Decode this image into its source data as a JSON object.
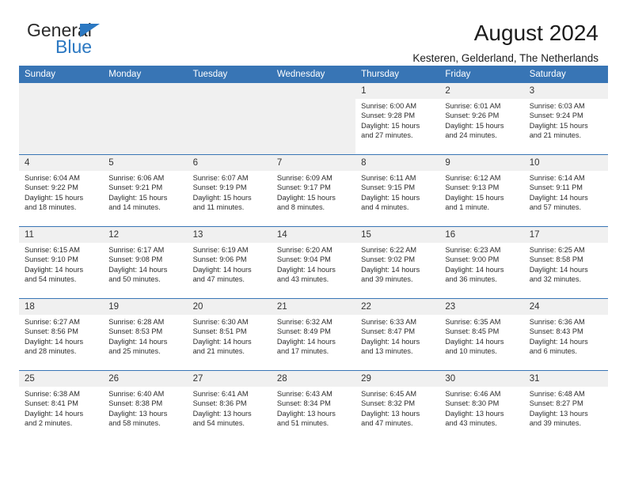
{
  "brand": {
    "name_top": "General",
    "name_bottom": "Blue",
    "triangle_color": "#2b78c2"
  },
  "header": {
    "title": "August 2024",
    "subtitle": "Kesteren, Gelderland, The Netherlands"
  },
  "theme": {
    "header_bg": "#3875b5",
    "daynum_bg": "#f0f0f0",
    "empty_cell_bg": "#f0f0f0",
    "grid_line": "#3875b5"
  },
  "calendar": {
    "weekday_headers": [
      "Sunday",
      "Monday",
      "Tuesday",
      "Wednesday",
      "Thursday",
      "Friday",
      "Saturday"
    ],
    "weeks": [
      [
        {
          "empty": true
        },
        {
          "empty": true
        },
        {
          "empty": true
        },
        {
          "empty": true
        },
        {
          "day": "1",
          "sunrise": "Sunrise: 6:00 AM",
          "sunset": "Sunset: 9:28 PM",
          "daylight1": "Daylight: 15 hours",
          "daylight2": "and 27 minutes."
        },
        {
          "day": "2",
          "sunrise": "Sunrise: 6:01 AM",
          "sunset": "Sunset: 9:26 PM",
          "daylight1": "Daylight: 15 hours",
          "daylight2": "and 24 minutes."
        },
        {
          "day": "3",
          "sunrise": "Sunrise: 6:03 AM",
          "sunset": "Sunset: 9:24 PM",
          "daylight1": "Daylight: 15 hours",
          "daylight2": "and 21 minutes."
        }
      ],
      [
        {
          "day": "4",
          "sunrise": "Sunrise: 6:04 AM",
          "sunset": "Sunset: 9:22 PM",
          "daylight1": "Daylight: 15 hours",
          "daylight2": "and 18 minutes."
        },
        {
          "day": "5",
          "sunrise": "Sunrise: 6:06 AM",
          "sunset": "Sunset: 9:21 PM",
          "daylight1": "Daylight: 15 hours",
          "daylight2": "and 14 minutes."
        },
        {
          "day": "6",
          "sunrise": "Sunrise: 6:07 AM",
          "sunset": "Sunset: 9:19 PM",
          "daylight1": "Daylight: 15 hours",
          "daylight2": "and 11 minutes."
        },
        {
          "day": "7",
          "sunrise": "Sunrise: 6:09 AM",
          "sunset": "Sunset: 9:17 PM",
          "daylight1": "Daylight: 15 hours",
          "daylight2": "and 8 minutes."
        },
        {
          "day": "8",
          "sunrise": "Sunrise: 6:11 AM",
          "sunset": "Sunset: 9:15 PM",
          "daylight1": "Daylight: 15 hours",
          "daylight2": "and 4 minutes."
        },
        {
          "day": "9",
          "sunrise": "Sunrise: 6:12 AM",
          "sunset": "Sunset: 9:13 PM",
          "daylight1": "Daylight: 15 hours",
          "daylight2": "and 1 minute."
        },
        {
          "day": "10",
          "sunrise": "Sunrise: 6:14 AM",
          "sunset": "Sunset: 9:11 PM",
          "daylight1": "Daylight: 14 hours",
          "daylight2": "and 57 minutes."
        }
      ],
      [
        {
          "day": "11",
          "sunrise": "Sunrise: 6:15 AM",
          "sunset": "Sunset: 9:10 PM",
          "daylight1": "Daylight: 14 hours",
          "daylight2": "and 54 minutes."
        },
        {
          "day": "12",
          "sunrise": "Sunrise: 6:17 AM",
          "sunset": "Sunset: 9:08 PM",
          "daylight1": "Daylight: 14 hours",
          "daylight2": "and 50 minutes."
        },
        {
          "day": "13",
          "sunrise": "Sunrise: 6:19 AM",
          "sunset": "Sunset: 9:06 PM",
          "daylight1": "Daylight: 14 hours",
          "daylight2": "and 47 minutes."
        },
        {
          "day": "14",
          "sunrise": "Sunrise: 6:20 AM",
          "sunset": "Sunset: 9:04 PM",
          "daylight1": "Daylight: 14 hours",
          "daylight2": "and 43 minutes."
        },
        {
          "day": "15",
          "sunrise": "Sunrise: 6:22 AM",
          "sunset": "Sunset: 9:02 PM",
          "daylight1": "Daylight: 14 hours",
          "daylight2": "and 39 minutes."
        },
        {
          "day": "16",
          "sunrise": "Sunrise: 6:23 AM",
          "sunset": "Sunset: 9:00 PM",
          "daylight1": "Daylight: 14 hours",
          "daylight2": "and 36 minutes."
        },
        {
          "day": "17",
          "sunrise": "Sunrise: 6:25 AM",
          "sunset": "Sunset: 8:58 PM",
          "daylight1": "Daylight: 14 hours",
          "daylight2": "and 32 minutes."
        }
      ],
      [
        {
          "day": "18",
          "sunrise": "Sunrise: 6:27 AM",
          "sunset": "Sunset: 8:56 PM",
          "daylight1": "Daylight: 14 hours",
          "daylight2": "and 28 minutes."
        },
        {
          "day": "19",
          "sunrise": "Sunrise: 6:28 AM",
          "sunset": "Sunset: 8:53 PM",
          "daylight1": "Daylight: 14 hours",
          "daylight2": "and 25 minutes."
        },
        {
          "day": "20",
          "sunrise": "Sunrise: 6:30 AM",
          "sunset": "Sunset: 8:51 PM",
          "daylight1": "Daylight: 14 hours",
          "daylight2": "and 21 minutes."
        },
        {
          "day": "21",
          "sunrise": "Sunrise: 6:32 AM",
          "sunset": "Sunset: 8:49 PM",
          "daylight1": "Daylight: 14 hours",
          "daylight2": "and 17 minutes."
        },
        {
          "day": "22",
          "sunrise": "Sunrise: 6:33 AM",
          "sunset": "Sunset: 8:47 PM",
          "daylight1": "Daylight: 14 hours",
          "daylight2": "and 13 minutes."
        },
        {
          "day": "23",
          "sunrise": "Sunrise: 6:35 AM",
          "sunset": "Sunset: 8:45 PM",
          "daylight1": "Daylight: 14 hours",
          "daylight2": "and 10 minutes."
        },
        {
          "day": "24",
          "sunrise": "Sunrise: 6:36 AM",
          "sunset": "Sunset: 8:43 PM",
          "daylight1": "Daylight: 14 hours",
          "daylight2": "and 6 minutes."
        }
      ],
      [
        {
          "day": "25",
          "sunrise": "Sunrise: 6:38 AM",
          "sunset": "Sunset: 8:41 PM",
          "daylight1": "Daylight: 14 hours",
          "daylight2": "and 2 minutes."
        },
        {
          "day": "26",
          "sunrise": "Sunrise: 6:40 AM",
          "sunset": "Sunset: 8:38 PM",
          "daylight1": "Daylight: 13 hours",
          "daylight2": "and 58 minutes."
        },
        {
          "day": "27",
          "sunrise": "Sunrise: 6:41 AM",
          "sunset": "Sunset: 8:36 PM",
          "daylight1": "Daylight: 13 hours",
          "daylight2": "and 54 minutes."
        },
        {
          "day": "28",
          "sunrise": "Sunrise: 6:43 AM",
          "sunset": "Sunset: 8:34 PM",
          "daylight1": "Daylight: 13 hours",
          "daylight2": "and 51 minutes."
        },
        {
          "day": "29",
          "sunrise": "Sunrise: 6:45 AM",
          "sunset": "Sunset: 8:32 PM",
          "daylight1": "Daylight: 13 hours",
          "daylight2": "and 47 minutes."
        },
        {
          "day": "30",
          "sunrise": "Sunrise: 6:46 AM",
          "sunset": "Sunset: 8:30 PM",
          "daylight1": "Daylight: 13 hours",
          "daylight2": "and 43 minutes."
        },
        {
          "day": "31",
          "sunrise": "Sunrise: 6:48 AM",
          "sunset": "Sunset: 8:27 PM",
          "daylight1": "Daylight: 13 hours",
          "daylight2": "and 39 minutes."
        }
      ]
    ]
  }
}
